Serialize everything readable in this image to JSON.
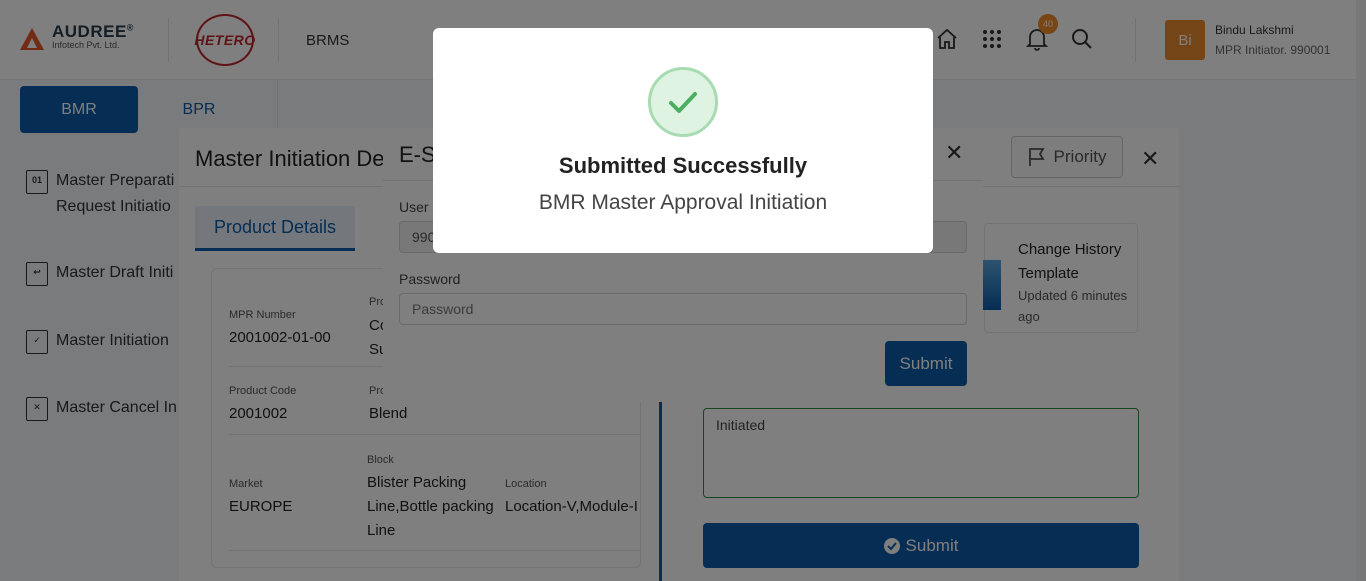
{
  "header": {
    "company_brand": "AUDREE",
    "company_sub": "Infotech Pvt. Ltd.",
    "client_logo": "HETERO",
    "app_name": "BRMS",
    "notification_count": "40",
    "user_initials": "Bi",
    "user_name": "Bindu Lakshmi",
    "user_role": "MPR Initiator. 990001",
    "icons": [
      "home-icon",
      "apps-grid-icon",
      "bell-icon",
      "search-icon"
    ]
  },
  "sidebar": {
    "tabs": [
      {
        "label": "BMR"
      },
      {
        "label": "BPR"
      }
    ],
    "items": [
      {
        "line1": "Master Preparati",
        "line2": "Request Initiatio"
      },
      {
        "line1": "Master Draft Initi"
      },
      {
        "line1": "Master Initiation"
      },
      {
        "line1": "Master Cancel In"
      }
    ]
  },
  "main_dialog": {
    "title": "Master Initiation De",
    "priority_label": "Priority",
    "close": "✕",
    "tab": "Product Details",
    "fields": {
      "mpr_number_label": "MPR Number",
      "mpr_number": "2001002-01-00",
      "product_name_label": "Pro",
      "product_name_line1": "Co",
      "product_name_line2": "Su",
      "product_code_label": "Product Code",
      "product_code": "2001002",
      "product_type_label": "Pro",
      "product_type": "Blend",
      "market_label": "Market",
      "market": "EUROPE",
      "block_label": "Block",
      "block_line1": "Blister Packing",
      "block_line2": "Line,Bottle packing",
      "block_line3": "Line",
      "location_label": "Location",
      "location": "Location-V,Module-I"
    },
    "change_history": {
      "title_line1": "Change History",
      "title_line2": "Template",
      "updated_line1": "Updated 6 minutes",
      "updated_line2": "ago"
    },
    "remarks": "Initiated",
    "submit_label": "Submit"
  },
  "esign_dialog": {
    "title": "E-S",
    "close": "✕",
    "user_label": "User I",
    "user_value": "990",
    "password_label": "Password",
    "password_placeholder": "Password",
    "submit_label": "Submit"
  },
  "success_popup": {
    "title": "Submitted Successfully",
    "message": "BMR Master Approval Initiation"
  }
}
